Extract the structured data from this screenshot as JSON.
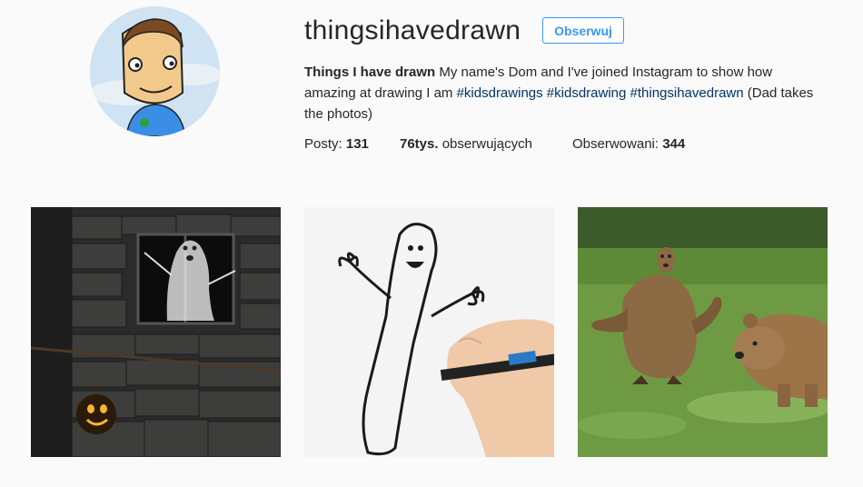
{
  "profile": {
    "username": "thingsihavedrawn",
    "follow_label": "Obserwuj",
    "bio_name": "Things I have drawn",
    "bio_text_1": " My name's Dom and I've joined Instagram to show how amazing at drawing I am ",
    "hashtags": [
      "#kidsdrawings",
      "#kidsdrawing",
      "#thingsihavedrawn"
    ],
    "bio_text_2": " (Dad takes the photos)"
  },
  "stats": {
    "posts_label": "Posty:",
    "posts_value": "131",
    "followers_value": "76tys.",
    "followers_label": "obserwujących",
    "following_label": "Obserwowani:",
    "following_value": "344"
  },
  "colors": {
    "accent": "#3897f0",
    "hashtag": "#003569",
    "text": "#262626",
    "background": "#fafafa"
  },
  "posts": [
    {
      "icon": "ghost-window-photo"
    },
    {
      "icon": "hand-drawing-photo"
    },
    {
      "icon": "bear-creature-photo"
    }
  ]
}
